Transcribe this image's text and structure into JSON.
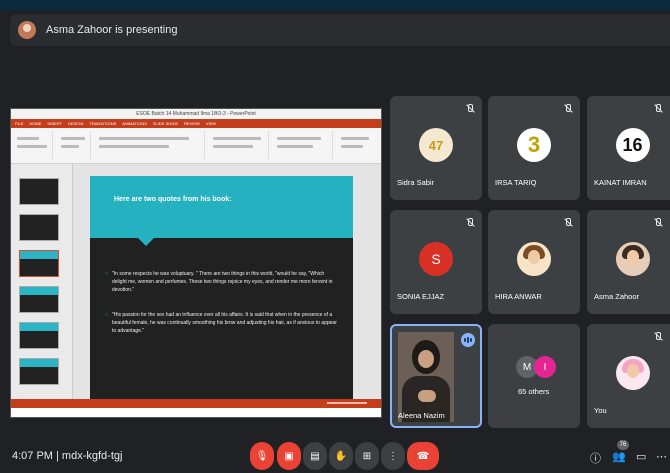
{
  "presenter": {
    "text": "Asma Zahoor is presenting"
  },
  "shared_screen": {
    "app_title": "ESOE Batch 14 Muhammad Ilma 1BO-3 - PowerPoint",
    "ribbon_tabs": [
      "FILE",
      "HOME",
      "INSERT",
      "DESIGN",
      "TRANSITIONS",
      "ANIMATIONS",
      "SLIDE SHOW",
      "REVIEW",
      "VIEW"
    ],
    "slide": {
      "title": "Here are two quotes from his book:",
      "bullets": [
        "\"In some respects he was voluptuary. \" There are two things in this world, \"would he say, \"Which delight me, women and perfumes. These two things rejoice my eyes, and render me more fervent in devotion.\"",
        "\"His passion for the sex had an influence over all his affairs. It is said that when in the presence of a beautiful female, he was continually smoothing his brow and adjusting his hair, as if anxious to appear to advantage.\""
      ]
    }
  },
  "participants": [
    {
      "name": "Sidra Sabir",
      "avatar": "47"
    },
    {
      "name": "IRSA TARIQ",
      "avatar": "3"
    },
    {
      "name": "KAINAT IMRAN",
      "avatar": "16"
    },
    {
      "name": "SONIA EJJAZ",
      "avatar": "S"
    },
    {
      "name": "HIRA ANWAR",
      "avatar": ""
    },
    {
      "name": "Asma Zahoor",
      "avatar": ""
    },
    {
      "name": "Aleena Nazim",
      "avatar": ""
    },
    {
      "name": "65 others",
      "avatar": "M",
      "avatar2": "I"
    },
    {
      "name": "You",
      "avatar": ""
    }
  ],
  "bottom_bar": {
    "time_code": "4:07 PM  |  mdx-kgfd-tgj",
    "raise_badge": "76"
  },
  "colors": {
    "end_call": "#ea4335",
    "accent": "#8ab4f8",
    "slide_teal": "#26b1c0"
  }
}
